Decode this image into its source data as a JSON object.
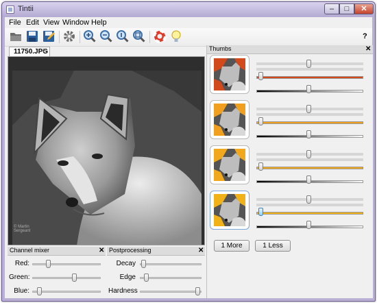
{
  "window": {
    "title": "Tintii",
    "minimize": "–",
    "maximize": "□",
    "close": "✕"
  },
  "menu": [
    "File",
    "Edit",
    "View",
    "Window",
    "Help"
  ],
  "toolbar": {
    "icons": [
      "open-folder-icon",
      "save-icon",
      "save-as-icon",
      "settings-gear-icon",
      "zoom-in-icon",
      "zoom-out-icon",
      "zoom-actual-icon",
      "zoom-fit-icon",
      "help-lifebuoy-icon",
      "tip-lightbulb-icon"
    ],
    "help_label": "?"
  },
  "document": {
    "tab_label": "11750.JPG",
    "tab_close": "✕",
    "watermark_line1": "© Martin",
    "watermark_line2": "Sergeant"
  },
  "channel_mixer": {
    "title": "Channel mixer",
    "close": "✕",
    "sliders": [
      {
        "label": "Red:",
        "value": 0.22
      },
      {
        "label": "Green:",
        "value": 0.62
      },
      {
        "label": "Blue:",
        "value": 0.08
      }
    ]
  },
  "postprocessing": {
    "title": "Postprocessing",
    "close": "✕",
    "sliders": [
      {
        "label": "Decay",
        "value": 0.02
      },
      {
        "label": "Edge",
        "value": 0.07
      },
      {
        "label": "Hardness",
        "value": 0.98
      }
    ]
  },
  "thumbs": {
    "title": "Thumbs",
    "close": "✕",
    "colors": [
      "#d24a1c",
      "#f0a01e",
      "#f2a81c",
      "#f0b218"
    ],
    "rows": [
      {
        "hue": 0.49,
        "saturation": 0.02,
        "value": 0.49,
        "selected": false
      },
      {
        "hue": 0.49,
        "saturation": 0.02,
        "value": 0.49,
        "selected": false
      },
      {
        "hue": 0.49,
        "saturation": 0.02,
        "value": 0.49,
        "selected": false
      },
      {
        "hue": 0.49,
        "saturation": 0.02,
        "value": 0.49,
        "selected": true
      }
    ],
    "more_button": "1 More",
    "less_button": "1 Less"
  }
}
